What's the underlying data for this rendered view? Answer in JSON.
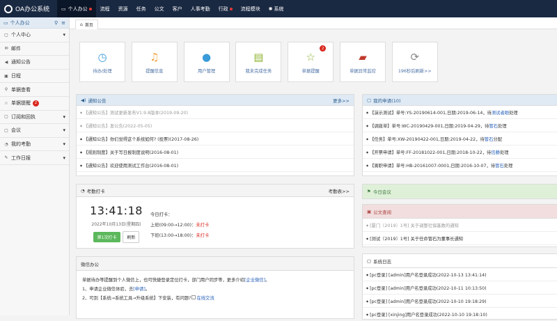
{
  "top": {
    "logo": "OA办公系统",
    "nav": [
      {
        "label": "个人办公",
        "active": true,
        "dot": true,
        "icon": "monitor"
      },
      {
        "label": "流程",
        "active": false,
        "dot": false
      },
      {
        "label": "资源",
        "active": false,
        "dot": false
      },
      {
        "label": "任务",
        "active": false,
        "dot": false
      },
      {
        "label": "公文",
        "active": false,
        "dot": false
      },
      {
        "label": "客户",
        "active": false,
        "dot": false
      },
      {
        "label": "人事考勤",
        "active": false,
        "dot": false
      },
      {
        "label": "行政",
        "active": false,
        "dot": true
      },
      {
        "label": "流程模块",
        "active": false,
        "dot": false
      },
      {
        "label": "系统",
        "active": false,
        "dot": false,
        "icon": "gear"
      }
    ]
  },
  "sidebar": {
    "header": "个人办公",
    "items": [
      {
        "label": "个人中心",
        "icon": "▢",
        "caret": true
      },
      {
        "label": "邮件",
        "icon": "✉",
        "caret": false
      },
      {
        "label": "通知公告",
        "icon": "◀",
        "caret": false
      },
      {
        "label": "日程",
        "icon": "▣",
        "caret": false
      },
      {
        "label": "单据查看",
        "icon": "⚲",
        "caret": false
      },
      {
        "label": "单据提醒",
        "icon": "☆",
        "caret": false,
        "badge": "2"
      },
      {
        "label": "订阅和回执",
        "icon": "▢",
        "caret": true
      },
      {
        "label": "会议",
        "icon": "▢",
        "caret": true
      },
      {
        "label": "我的考勤",
        "icon": "◔",
        "caret": true
      },
      {
        "label": "工作日报",
        "icon": "✎",
        "caret": true
      }
    ]
  },
  "tab": {
    "label": "首页"
  },
  "tiles": [
    {
      "label": "待办/处理",
      "icon": "clock-icon",
      "color": "#3a9bd9"
    },
    {
      "label": "提醒信息",
      "icon": "bell-icon",
      "color": "#f0a23b"
    },
    {
      "label": "用户管理",
      "icon": "user-icon",
      "color": "#3a9bd9"
    },
    {
      "label": "我未完成任务",
      "icon": "book-icon",
      "color": "#8cb32e"
    },
    {
      "label": "单据提醒",
      "icon": "star-icon",
      "color": "#8cb32e",
      "badge": "2"
    },
    {
      "label": "单据异常监控",
      "icon": "briefcase-icon",
      "color": "#c0392b"
    },
    {
      "label": "196秒后刷新>>",
      "icon": "refresh-icon",
      "color": "#888888"
    }
  ],
  "notice": {
    "title": "通知公告",
    "more": "更多>>",
    "items": [
      {
        "text": "【通知公告】测试更新发布V1.9.8版本(2019-09-20)",
        "grey": true
      },
      {
        "text": "【通知公告】发公告(2022-05-05)",
        "grey": true
      },
      {
        "text": "【通知公告】你们觉得这个系统如何? (投票)(2017-08-26)",
        "grey": false
      },
      {
        "text": "【规则制度】关于写日报制度说明(2016-08-01)",
        "grey": false
      },
      {
        "text": "【通知公告】欢迎使用测试工作台(2016-08-01)",
        "grey": false
      }
    ]
  },
  "myapply": {
    "title": "我的申请(10)",
    "items": [
      {
        "pre": "【演示测试】单号:YS-20190614-001,日期:2019-06-14，待",
        "who": "测试者眼",
        "post": "处理"
      },
      {
        "pre": "【调拨单】单号:WC-20190429-001,日期:2019-04-29，待",
        "who": "管石",
        "post": "处理"
      },
      {
        "pre": "【任务】单号:XW-20190422-001,日期:2019-04-22，待",
        "who": "管石",
        "post": "分配"
      },
      {
        "pre": "【开票申请】单号:FF-20181022-001,日期:2018-10-22，待",
        "who": "信静",
        "post": "处理"
      },
      {
        "pre": "【离职申请】单号:HB-20161007-0001,日期:2016-10-07，待",
        "who": "管石",
        "post": "处理"
      }
    ]
  },
  "clock": {
    "title": "考勤打卡",
    "more": "考勤表>>",
    "time": "13:41:18",
    "date": "2022年10月13日(星期四)",
    "today_label": "今日打卡：",
    "rows": [
      {
        "label": "上班(09:00→12:00)：",
        "status": "未打卡"
      },
      {
        "label": "下班(13:00→18:00)：",
        "status": "未打卡"
      }
    ],
    "punch_btn": "第1次打卡",
    "refresh_btn": "刷新"
  },
  "meeting": {
    "title": "今日会议"
  },
  "docs": {
    "title": "公文查阅",
    "items": [
      {
        "text": "[厦门〔2019〕1号] 关于调整社保基数的通知",
        "grey": true
      },
      {
        "text": "[测试〔2019〕1号] 关于任命管石为董事长通知",
        "grey": false
      }
    ]
  },
  "wechat": {
    "title": "微信办公",
    "line1_pre": "单据待办等提醒到个人微信上，也可快捷登录定位打卡，部门用户同步等，更多介绍",
    "line1_link": "[企业微信]",
    "line1_post": "。",
    "line2_pre": "1、申请企业微信体验，去",
    "line2_link": "[申请]",
    "line2_post": "。",
    "line3_pre": "2、可到【系统→系统工具→升级系统】下安装，有问题?",
    "line3_link": "在线交流"
  },
  "syslog": {
    "title": "系统日志",
    "items": [
      "[pc登录] [admin]用户名登录成功(2022-10-13 13:41:14)",
      "[pc登录] [admin]用户名登录成功(2022-10-11 10:13:50)",
      "[pc登录] [admin]用户名登录成功(2022-10-10 19:18:29)",
      "[pc登录] [xinjing]用户名登录成功(2022-10-10 19:18:10)"
    ]
  }
}
